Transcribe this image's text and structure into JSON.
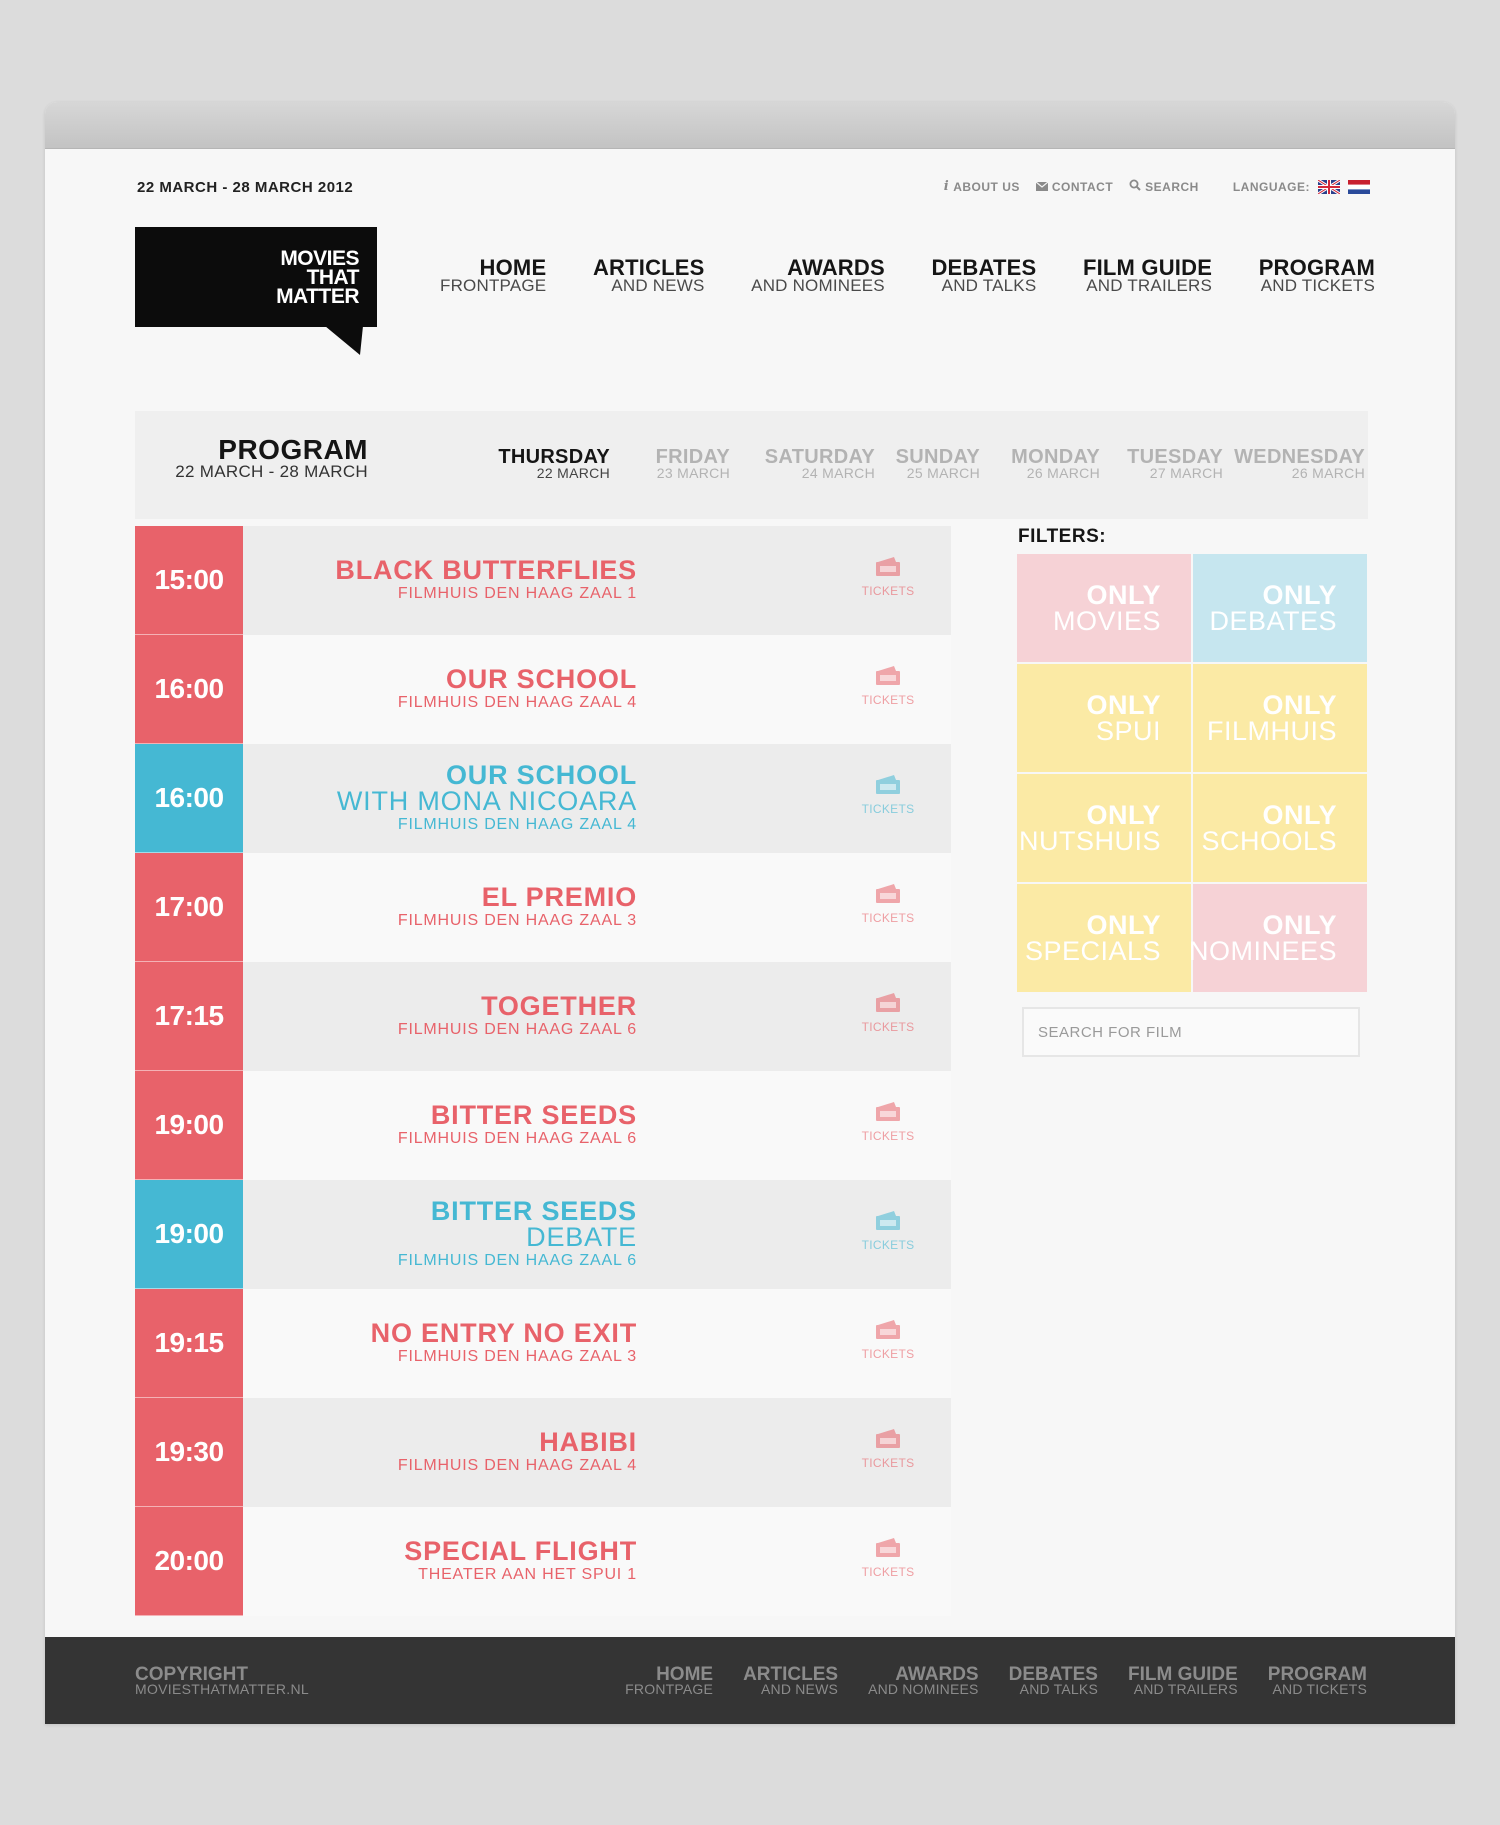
{
  "header": {
    "dates": "22 MARCH - 28 MARCH 2012",
    "util": [
      {
        "label": "ABOUT US",
        "icon": "info-icon"
      },
      {
        "label": "CONTACT",
        "icon": "mail-icon"
      },
      {
        "label": "SEARCH",
        "icon": "search-icon"
      }
    ],
    "language_label": "LANGUAGE:"
  },
  "logo": {
    "text": "MOVIES\nTHAT\nMATTER"
  },
  "nav": [
    {
      "title": "HOME",
      "sub": "FRONTPAGE"
    },
    {
      "title": "ARTICLES",
      "sub": "AND NEWS"
    },
    {
      "title": "AWARDS",
      "sub": "AND NOMINEES"
    },
    {
      "title": "DEBATES",
      "sub": "AND TALKS"
    },
    {
      "title": "FILM GUIDE",
      "sub": "AND TRAILERS"
    },
    {
      "title": "PROGRAM",
      "sub": "AND TICKETS"
    }
  ],
  "program": {
    "title": "PROGRAM",
    "sub": "22 MARCH - 28 MARCH",
    "days": [
      {
        "name": "THURSDAY",
        "date": "22 MARCH",
        "active": true
      },
      {
        "name": "FRIDAY",
        "date": "23 MARCH",
        "active": false
      },
      {
        "name": "SATURDAY",
        "date": "24 MARCH",
        "active": false
      },
      {
        "name": "SUNDAY",
        "date": "25 MARCH",
        "active": false
      },
      {
        "name": "MONDAY",
        "date": "26 MARCH",
        "active": false
      },
      {
        "name": "TUESDAY",
        "date": "27 MARCH",
        "active": false
      },
      {
        "name": "WEDNESDAY",
        "date": "26 MARCH",
        "active": false
      }
    ]
  },
  "colors": {
    "movie": "#e8626a",
    "debate": "#45b8d3",
    "pink_tile": "#f6d2d6",
    "blue_tile": "#c6e6ef",
    "yellow_tile": "#fbeaa5"
  },
  "schedule": [
    {
      "time": "15:00",
      "title": "BLACK BUTTERFLIES",
      "sub2": "",
      "venue": "FILMHUIS DEN HAAG ZAAL 1",
      "kind": "movie",
      "ticket": "TICKETS"
    },
    {
      "time": "16:00",
      "title": "OUR SCHOOL",
      "sub2": "",
      "venue": "FILMHUIS DEN HAAG ZAAL 4",
      "kind": "movie",
      "ticket": "TICKETS"
    },
    {
      "time": "16:00",
      "title": "OUR SCHOOL",
      "sub2": "WITH MONA NICOARA",
      "venue": "FILMHUIS DEN HAAG ZAAL 4",
      "kind": "debate",
      "ticket": "TICKETS"
    },
    {
      "time": "17:00",
      "title": "EL PREMIO",
      "sub2": "",
      "venue": "FILMHUIS DEN HAAG ZAAL 3",
      "kind": "movie",
      "ticket": "TICKETS"
    },
    {
      "time": "17:15",
      "title": "TOGETHER",
      "sub2": "",
      "venue": "FILMHUIS DEN HAAG ZAAL 6",
      "kind": "movie",
      "ticket": "TICKETS"
    },
    {
      "time": "19:00",
      "title": "BITTER SEEDS",
      "sub2": "",
      "venue": "FILMHUIS DEN HAAG ZAAL 6",
      "kind": "movie",
      "ticket": "TICKETS"
    },
    {
      "time": "19:00",
      "title": "BITTER SEEDS",
      "sub2": "DEBATE",
      "venue": "FILMHUIS DEN HAAG ZAAL 6",
      "kind": "debate",
      "ticket": "TICKETS"
    },
    {
      "time": "19:15",
      "title": "NO ENTRY NO EXIT",
      "sub2": "",
      "venue": "FILMHUIS DEN HAAG ZAAL 3",
      "kind": "movie",
      "ticket": "TICKETS"
    },
    {
      "time": "19:30",
      "title": "HABIBI",
      "sub2": "",
      "venue": "FILMHUIS DEN HAAG ZAAL 4",
      "kind": "movie",
      "ticket": "TICKETS"
    },
    {
      "time": "20:00",
      "title": "SPECIAL FLIGHT",
      "sub2": "",
      "venue": "THEATER AAN HET SPUI 1",
      "kind": "movie",
      "ticket": "TICKETS"
    }
  ],
  "filters": {
    "label": "FILTERS:",
    "items": [
      {
        "only": "ONLY",
        "name": "MOVIES",
        "tile": "pink"
      },
      {
        "only": "ONLY",
        "name": "DEBATES",
        "tile": "blue"
      },
      {
        "only": "ONLY",
        "name": "SPUI",
        "tile": "yellow"
      },
      {
        "only": "ONLY",
        "name": "FILMHUIS",
        "tile": "yellow"
      },
      {
        "only": "ONLY",
        "name": "NUTSHUIS",
        "tile": "yellow"
      },
      {
        "only": "ONLY",
        "name": "SCHOOLS",
        "tile": "yellow"
      },
      {
        "only": "ONLY",
        "name": "SPECIALS",
        "tile": "yellow"
      },
      {
        "only": "ONLY",
        "name": "NOMINEES",
        "tile": "pink"
      }
    ],
    "search_placeholder": "SEARCH FOR FILM"
  },
  "footer": {
    "copy_title": "COPYRIGHT",
    "copy_sub": "MOVIESTHATMATTER.NL",
    "nav": [
      {
        "title": "HOME",
        "sub": "FRONTPAGE"
      },
      {
        "title": "ARTICLES",
        "sub": "AND NEWS"
      },
      {
        "title": "AWARDS",
        "sub": "AND NOMINEES"
      },
      {
        "title": "DEBATES",
        "sub": "AND TALKS"
      },
      {
        "title": "FILM GUIDE",
        "sub": "AND TRAILERS"
      },
      {
        "title": "PROGRAM",
        "sub": "AND TICKETS"
      }
    ]
  }
}
